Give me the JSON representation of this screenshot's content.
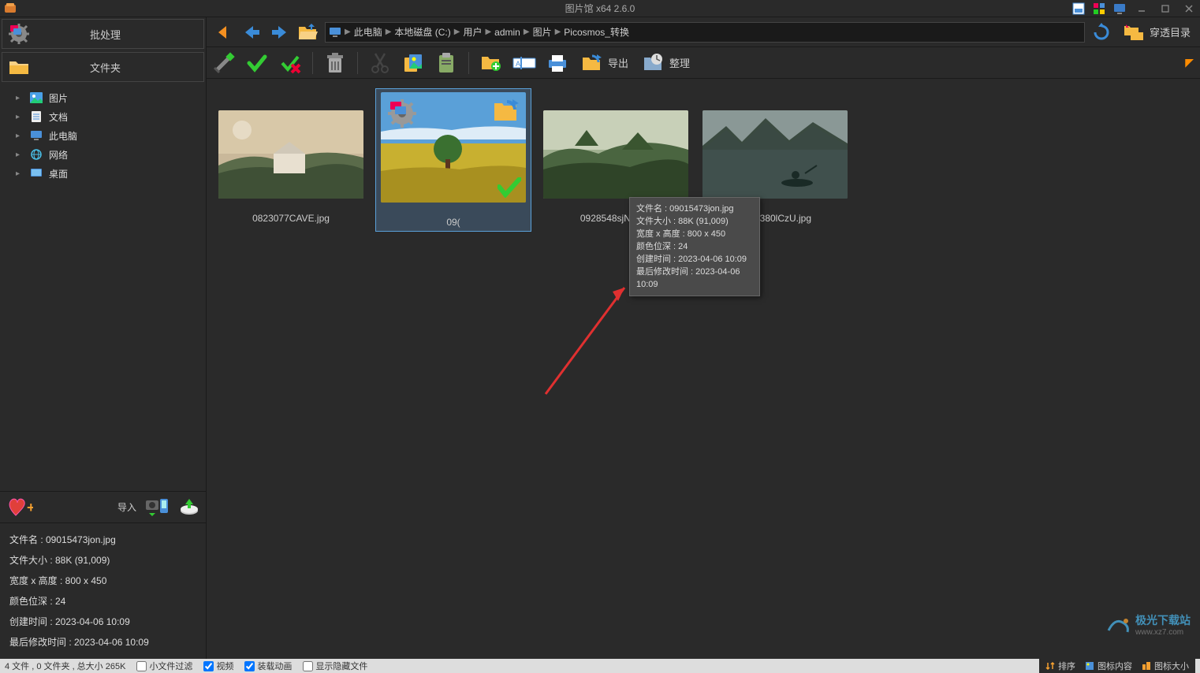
{
  "titlebar": {
    "title": "图片馆 x64 2.6.0"
  },
  "sidebar": {
    "batch_label": "批处理",
    "folder_label": "文件夹",
    "tree": [
      {
        "label": "图片"
      },
      {
        "label": "文档"
      },
      {
        "label": "此电脑"
      },
      {
        "label": "网络"
      },
      {
        "label": "桌面"
      }
    ],
    "import_label": "导入"
  },
  "info": {
    "lines": [
      "文件名 : 09015473jon.jpg",
      "文件大小 : 88K (91,009)",
      "宽度 x 高度 : 800 x 450",
      "颜色位深 : 24",
      "创建时间 : 2023-04-06 10:09",
      "最后修改时间 : 2023-04-06 10:09"
    ]
  },
  "path": {
    "segments": [
      "此电脑",
      "本地磁盘 (C:)",
      "用户",
      "admin",
      "图片",
      "Picosmos_转换"
    ]
  },
  "penetrate_label": "穿透目录",
  "toolbar": {
    "export_label": "导出",
    "organize_label": "整理"
  },
  "thumbs": [
    {
      "label": "0823077CAVE.jpg"
    },
    {
      "label": "09015473jon.jpg",
      "selected": true
    },
    {
      "label": "0928548sjNV.jpg"
    },
    {
      "label": "0934380lCzU.jpg"
    }
  ],
  "tooltip": {
    "lines": [
      "文件名 : 09015473jon.jpg",
      "文件大小 : 88K (91,009)",
      "宽度 x 高度 : 800 x 450",
      "颜色位深 : 24",
      "创建时间 : 2023-04-06 10:09",
      "最后修改时间 : 2023-04-06 10:09"
    ]
  },
  "status": {
    "summary": "4 文件 , 0 文件夹 , 总大小 265K",
    "chk1": "小文件过滤",
    "chk2": "视频",
    "chk3": "装载动画",
    "chk4": "显示隐藏文件",
    "r1": "排序",
    "r2": "图标内容",
    "r3": "图标大小"
  },
  "watermark": {
    "brand": "极光下载站",
    "url": "www.xz7.com"
  }
}
